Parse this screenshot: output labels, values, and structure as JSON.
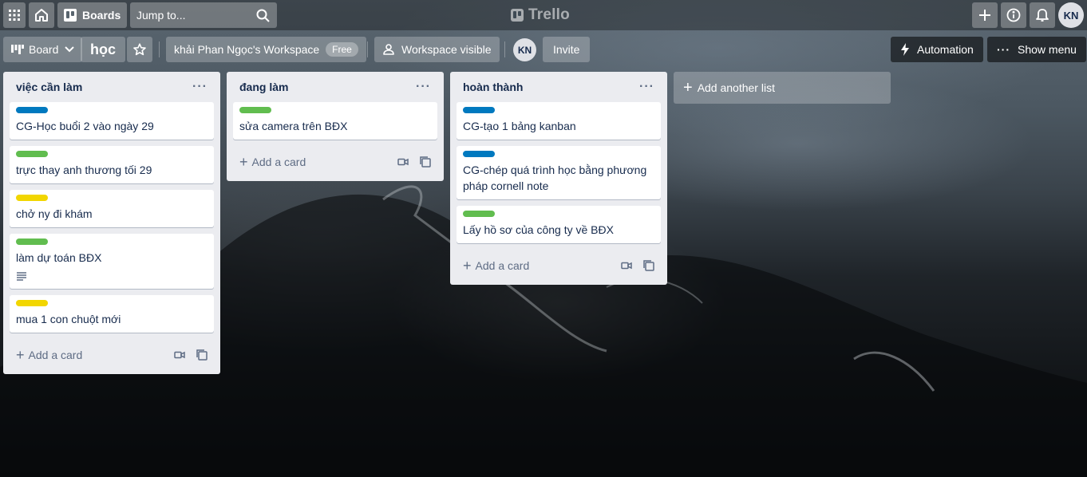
{
  "colors": {
    "label_blue": "#0079bf",
    "label_green": "#61bd4f",
    "label_yellow": "#f2d600"
  },
  "topbar": {
    "boards_label": "Boards",
    "search_placeholder": "Jump to...",
    "logo_text": "Trello",
    "avatar_initials": "KN",
    "icons": [
      "apps-grid-icon",
      "home-icon",
      "boards-icon",
      "search-icon",
      "plus-icon",
      "info-icon",
      "bell-icon"
    ]
  },
  "board_header": {
    "view_label": "Board",
    "board_title": "học",
    "workspace_name": "khải Phan Ngọc's Workspace",
    "workspace_badge": "Free",
    "visibility_label": "Workspace visible",
    "member_initials": "KN",
    "invite_label": "Invite",
    "automation_label": "Automation",
    "show_menu_label": "Show menu"
  },
  "lists": [
    {
      "title": "việc cần làm",
      "menu": "···",
      "cards": [
        {
          "label": "blue",
          "text": "CG-Học buổi 2 vào ngày 29"
        },
        {
          "label": "green",
          "text": "trực thay anh thương tối 29"
        },
        {
          "label": "yellow",
          "text": "chở ny đi khám"
        },
        {
          "label": "green",
          "text": "làm dự toán BĐX",
          "has_description": true
        },
        {
          "label": "yellow",
          "text": "mua 1 con chuột mới"
        }
      ],
      "add_card_label": "Add a card"
    },
    {
      "title": "đang làm",
      "menu": "···",
      "cards": [
        {
          "label": "green",
          "text": "sửa camera trên BĐX"
        }
      ],
      "add_card_label": "Add a card"
    },
    {
      "title": "hoàn thành",
      "menu": "···",
      "cards": [
        {
          "label": "blue",
          "text": "CG-tạo 1 bảng kanban"
        },
        {
          "label": "blue",
          "text": "CG-chép quá trình học bằng phương pháp cornell note"
        },
        {
          "label": "green",
          "text": "Lấy hồ sơ của công ty về BĐX"
        }
      ],
      "add_card_label": "Add a card"
    }
  ],
  "add_list_label": "Add another list"
}
